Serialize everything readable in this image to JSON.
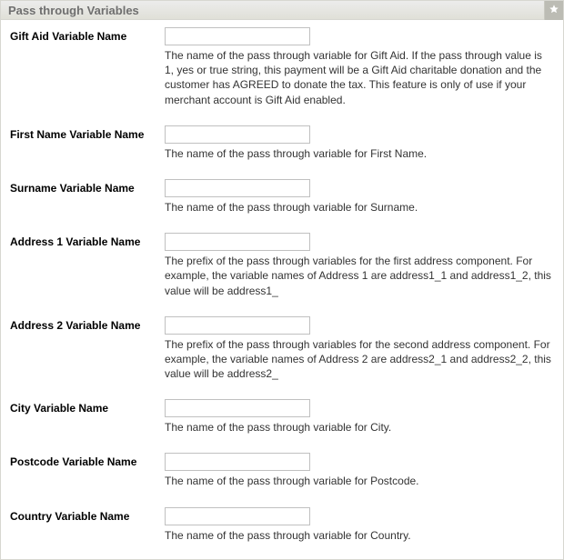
{
  "header": {
    "title": "Pass through Variables"
  },
  "fields": [
    {
      "key": "giftaid",
      "label": "Gift Aid Variable Name",
      "value": "",
      "description": "The name of the pass through variable for Gift Aid. If the pass through value is 1, yes or true string, this payment will be a Gift Aid charitable donation and the customer has AGREED to donate the tax. This feature is only of use if your merchant account is Gift Aid enabled."
    },
    {
      "key": "firstname",
      "label": "First Name Variable Name",
      "value": "",
      "description": "The name of the pass through variable for First Name."
    },
    {
      "key": "surname",
      "label": "Surname Variable Name",
      "value": "",
      "description": "The name of the pass through variable for Surname."
    },
    {
      "key": "address1",
      "label": "Address 1 Variable Name",
      "value": "",
      "description": "The prefix of the pass through variables for the first address component. For example, the variable names of Address 1 are address1_1 and address1_2, this value will be address1_"
    },
    {
      "key": "address2",
      "label": "Address 2 Variable Name",
      "value": "",
      "description": "The prefix of the pass through variables for the second address component. For example, the variable names of Address 2 are address2_1 and address2_2, this value will be address2_"
    },
    {
      "key": "city",
      "label": "City Variable Name",
      "value": "",
      "description": "The name of the pass through variable for City."
    },
    {
      "key": "postcode",
      "label": "Postcode Variable Name",
      "value": "",
      "description": "The name of the pass through variable for Postcode."
    },
    {
      "key": "country",
      "label": "Country Variable Name",
      "value": "",
      "description": "The name of the pass through variable for Country."
    }
  ]
}
